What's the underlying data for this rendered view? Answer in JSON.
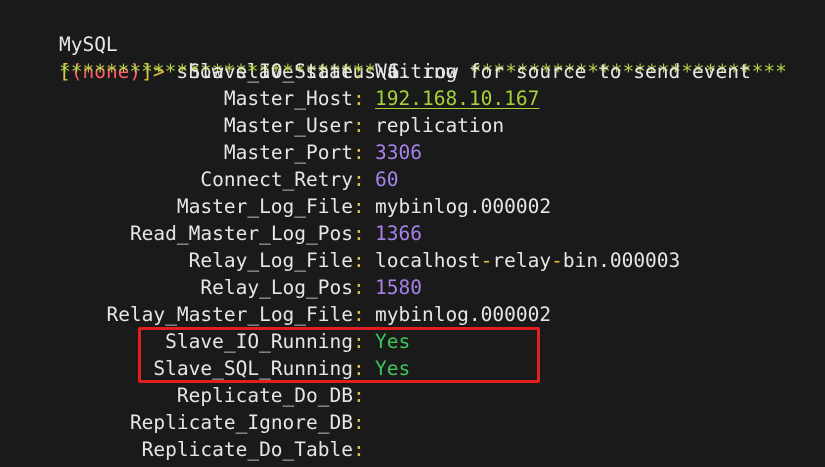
{
  "prompt": {
    "app": "MySQL",
    "open_bracket": "[",
    "db": "(none)",
    "close_bracket": "]>",
    "command": " show slave status\\G"
  },
  "separator": {
    "left": "*************************** ",
    "mid": "1. row",
    "right": " ***************************"
  },
  "rows": [
    {
      "label": "Slave_IO_State",
      "value": "Waiting for source to send event",
      "kind": "text"
    },
    {
      "label": "Master_Host",
      "value": "192.168.10.167",
      "kind": "ip"
    },
    {
      "label": "Master_User",
      "value": "replication",
      "kind": "text"
    },
    {
      "label": "Master_Port",
      "value": "3306",
      "kind": "num"
    },
    {
      "label": "Connect_Retry",
      "value": "60",
      "kind": "num"
    },
    {
      "label": "Master_Log_File",
      "value": "mybinlog.000002",
      "kind": "text"
    },
    {
      "label": "Read_Master_Log_Pos",
      "value": "1366",
      "kind": "num"
    },
    {
      "label": "Relay_Log_File",
      "value_a": "localhost",
      "value_dash1": "-",
      "value_b": "relay",
      "value_dash2": "-",
      "value_c": "bin.000003",
      "kind": "relay"
    },
    {
      "label": "Relay_Log_Pos",
      "value": "1580",
      "kind": "num"
    },
    {
      "label": "Relay_Master_Log_File",
      "value": "mybinlog.000002",
      "kind": "text"
    },
    {
      "label": "Slave_IO_Running",
      "value": "Yes",
      "kind": "yes"
    },
    {
      "label": "Slave_SQL_Running",
      "value": "Yes",
      "kind": "yes"
    },
    {
      "label": "Replicate_Do_DB",
      "value": "",
      "kind": "text"
    },
    {
      "label": "Replicate_Ignore_DB",
      "value": "",
      "kind": "text"
    },
    {
      "label": "Replicate_Do_Table",
      "value": "",
      "kind": "text"
    }
  ],
  "colors": {
    "background": "#1a1a1a",
    "separator": "#b5d447",
    "number": "#a582e8",
    "ip": "#a6d13a",
    "yes": "#3fc65a",
    "highlight_box": "#e02020"
  }
}
